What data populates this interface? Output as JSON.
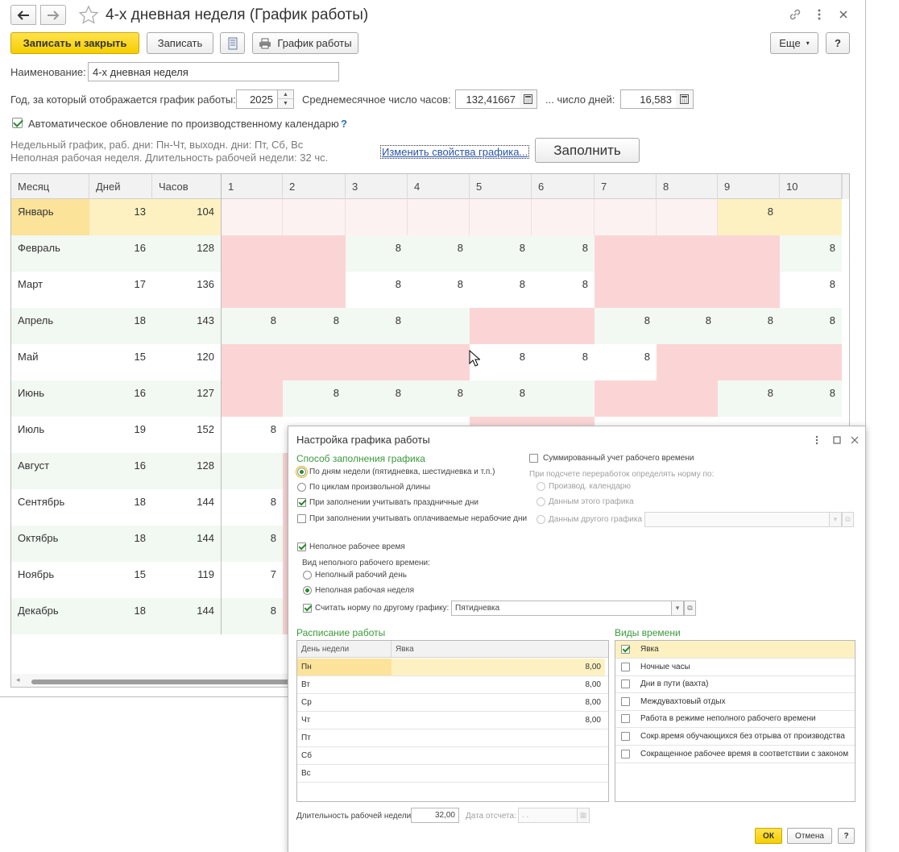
{
  "window": {
    "title": "4-х дневная неделя (График работы)"
  },
  "toolbar": {
    "save_close": "Записать и закрыть",
    "save": "Записать",
    "schedule": "График работы",
    "more": "Еще",
    "help": "?"
  },
  "form": {
    "name_label": "Наименование:",
    "name_value": "4-х дневная неделя",
    "year_label": "Год, за который отображается график работы:",
    "year_value": "2025",
    "avg_hours_label": "Среднемесячное число часов:",
    "avg_hours_value": "132,41667",
    "days_label": "... число дней:",
    "days_value": "16,583",
    "auto_update_label": "Автоматическое обновление по производственному календарю",
    "auto_update_checked": true,
    "help_mark": "?",
    "info_line1": "Недельный график, раб. дни: Пн-Чт, выходн. дни: Пт, Сб, Вс",
    "info_line2": "Неполная рабочая неделя. Длительность рабочей недели: 32 чс.",
    "change_link": "Изменить свойства графика...",
    "fill_button": "Заполнить"
  },
  "grid": {
    "headers": [
      "Месяц",
      "Дней",
      "Часов",
      "1",
      "2",
      "3",
      "4",
      "5",
      "6",
      "7",
      "8",
      "9",
      "10"
    ],
    "rows": [
      {
        "month": "Январь",
        "days": "13",
        "hours": "104",
        "cells": [
          "",
          "",
          "",
          "",
          "",
          "",
          "",
          "",
          "8",
          ""
        ]
      },
      {
        "month": "Февраль",
        "days": "16",
        "hours": "128",
        "cells": [
          "",
          "",
          "8",
          "8",
          "8",
          "8",
          "",
          "",
          "",
          "8"
        ]
      },
      {
        "month": "Март",
        "days": "17",
        "hours": "136",
        "cells": [
          "",
          "",
          "8",
          "8",
          "8",
          "8",
          "",
          "",
          "",
          "8"
        ]
      },
      {
        "month": "Апрель",
        "days": "18",
        "hours": "143",
        "cells": [
          "8",
          "8",
          "8",
          "",
          "",
          "",
          "8",
          "8",
          "8",
          "8"
        ]
      },
      {
        "month": "Май",
        "days": "15",
        "hours": "120",
        "cells": [
          "",
          "",
          "",
          "",
          "8",
          "8",
          "8",
          "",
          "",
          ""
        ]
      },
      {
        "month": "Июнь",
        "days": "16",
        "hours": "127",
        "cells": [
          "",
          "8",
          "8",
          "8",
          "8",
          "",
          "",
          "",
          "8",
          "8"
        ]
      },
      {
        "month": "Июль",
        "days": "19",
        "hours": "152",
        "cells": [
          "8",
          "",
          "",
          "",
          "",
          "",
          "",
          "",
          "",
          ""
        ]
      },
      {
        "month": "Август",
        "days": "16",
        "hours": "128",
        "cells": [
          "",
          "",
          "",
          "",
          "",
          "",
          "",
          "",
          "",
          ""
        ]
      },
      {
        "month": "Сентябрь",
        "days": "18",
        "hours": "144",
        "cells": [
          "8",
          "",
          "",
          "",
          "",
          "",
          "",
          "",
          "",
          ""
        ]
      },
      {
        "month": "Октябрь",
        "days": "18",
        "hours": "144",
        "cells": [
          "8",
          "",
          "",
          "",
          "",
          "",
          "",
          "",
          "",
          ""
        ]
      },
      {
        "month": "Ноябрь",
        "days": "15",
        "hours": "119",
        "cells": [
          "7",
          "",
          "",
          "",
          "",
          "",
          "",
          "",
          "",
          ""
        ]
      },
      {
        "month": "Декабрь",
        "days": "18",
        "hours": "144",
        "cells": [
          "8",
          "",
          "",
          "",
          "",
          "",
          "",
          "",
          "",
          ""
        ]
      }
    ],
    "colors": {
      "holiday": "#fbd5d5",
      "selected_month": "#fbe39a",
      "selected_num": "#fdf1c2",
      "alt_row": "#f2f8f2"
    }
  },
  "dialog": {
    "title": "Настройка графика работы",
    "fill_method_title": "Способ заполнения графика",
    "by_weekdays": "По дням недели (пятидневка, шестидневка и т.п.)",
    "by_cycles": "По циклам произвольной длины",
    "consider_holidays": "При заполнении учитывать праздничные дни",
    "consider_paid": "При заполнении учитывать оплачиваемые нерабочие дни",
    "summarized": "Суммированный учет рабочего времени",
    "overtime_label": "При подсчете переработок определять норму по:",
    "opt_calendar": "Производ. календарю",
    "opt_this": "Данным этого графика",
    "opt_other": "Данным другого графика",
    "part_time": "Неполное рабочее время",
    "part_time_kind_label": "Вид неполного рабочего времени:",
    "part_day": "Неполный рабочий день",
    "part_week": "Неполная рабочая неделя",
    "norm_other": "Считать норму по другому графику:",
    "norm_other_value": "Пятидневка",
    "schedule_title": "Расписание работы",
    "schedule_headers": [
      "День недели",
      "Явка"
    ],
    "schedule_rows": [
      {
        "day": "Пн",
        "value": "8,00"
      },
      {
        "day": "Вт",
        "value": "8,00"
      },
      {
        "day": "Ср",
        "value": "8,00"
      },
      {
        "day": "Чт",
        "value": "8,00"
      },
      {
        "day": "Пт",
        "value": ""
      },
      {
        "day": "Сб",
        "value": ""
      },
      {
        "day": "Вс",
        "value": ""
      }
    ],
    "time_types_title": "Виды времени",
    "time_types": [
      {
        "label": "Явка",
        "checked": true
      },
      {
        "label": "Ночные часы",
        "checked": false
      },
      {
        "label": "Дни в пути (вахта)",
        "checked": false
      },
      {
        "label": "Междувахтовый отдых",
        "checked": false
      },
      {
        "label": "Работа в режиме неполного рабочего времени",
        "checked": false
      },
      {
        "label": "Сокр.время обучающихся без отрыва от производства",
        "checked": false
      },
      {
        "label": "Сокращенное рабочее время в соответствии с законом",
        "checked": false
      }
    ],
    "week_duration_label": "Длительность рабочей недели:",
    "week_duration_value": "32,00",
    "ref_date_label": "Дата отсчета:",
    "ref_date_value": ". .",
    "ok": "ОК",
    "cancel": "Отмена",
    "help": "?"
  }
}
